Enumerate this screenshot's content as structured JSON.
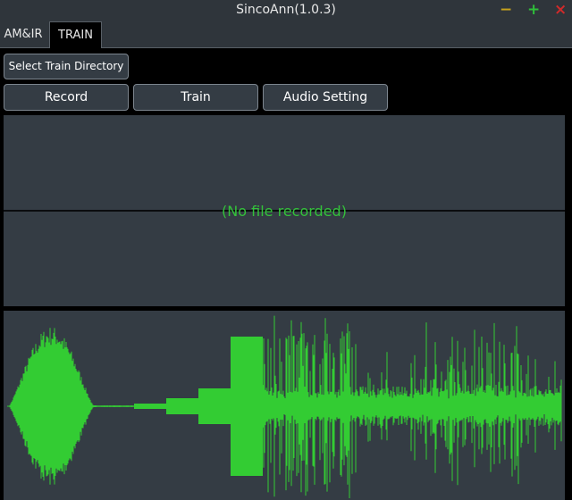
{
  "window": {
    "title": "SincoAnn(1.0.3)"
  },
  "window_controls": {
    "minimize": "−",
    "maximize": "+",
    "close": "×"
  },
  "tabs": [
    {
      "label": "AM&IR",
      "active": false
    },
    {
      "label": "TRAIN",
      "active": true
    }
  ],
  "toolbar": {
    "select_dir_label": "Select Train Directory",
    "record_label": "Record",
    "train_label": "Train",
    "audio_setting_label": "Audio Setting"
  },
  "recording": {
    "empty_message": "(No file recorded)"
  },
  "colors": {
    "panel": "#343c44",
    "waveform": "#33cc33",
    "message": "#33c23a",
    "minimize": "#c8a21c",
    "maximize": "#2fbf3a",
    "close": "#d02a2a"
  },
  "icons": {
    "minimize": "minimize-icon",
    "maximize": "maximize-icon",
    "close": "close-icon"
  }
}
